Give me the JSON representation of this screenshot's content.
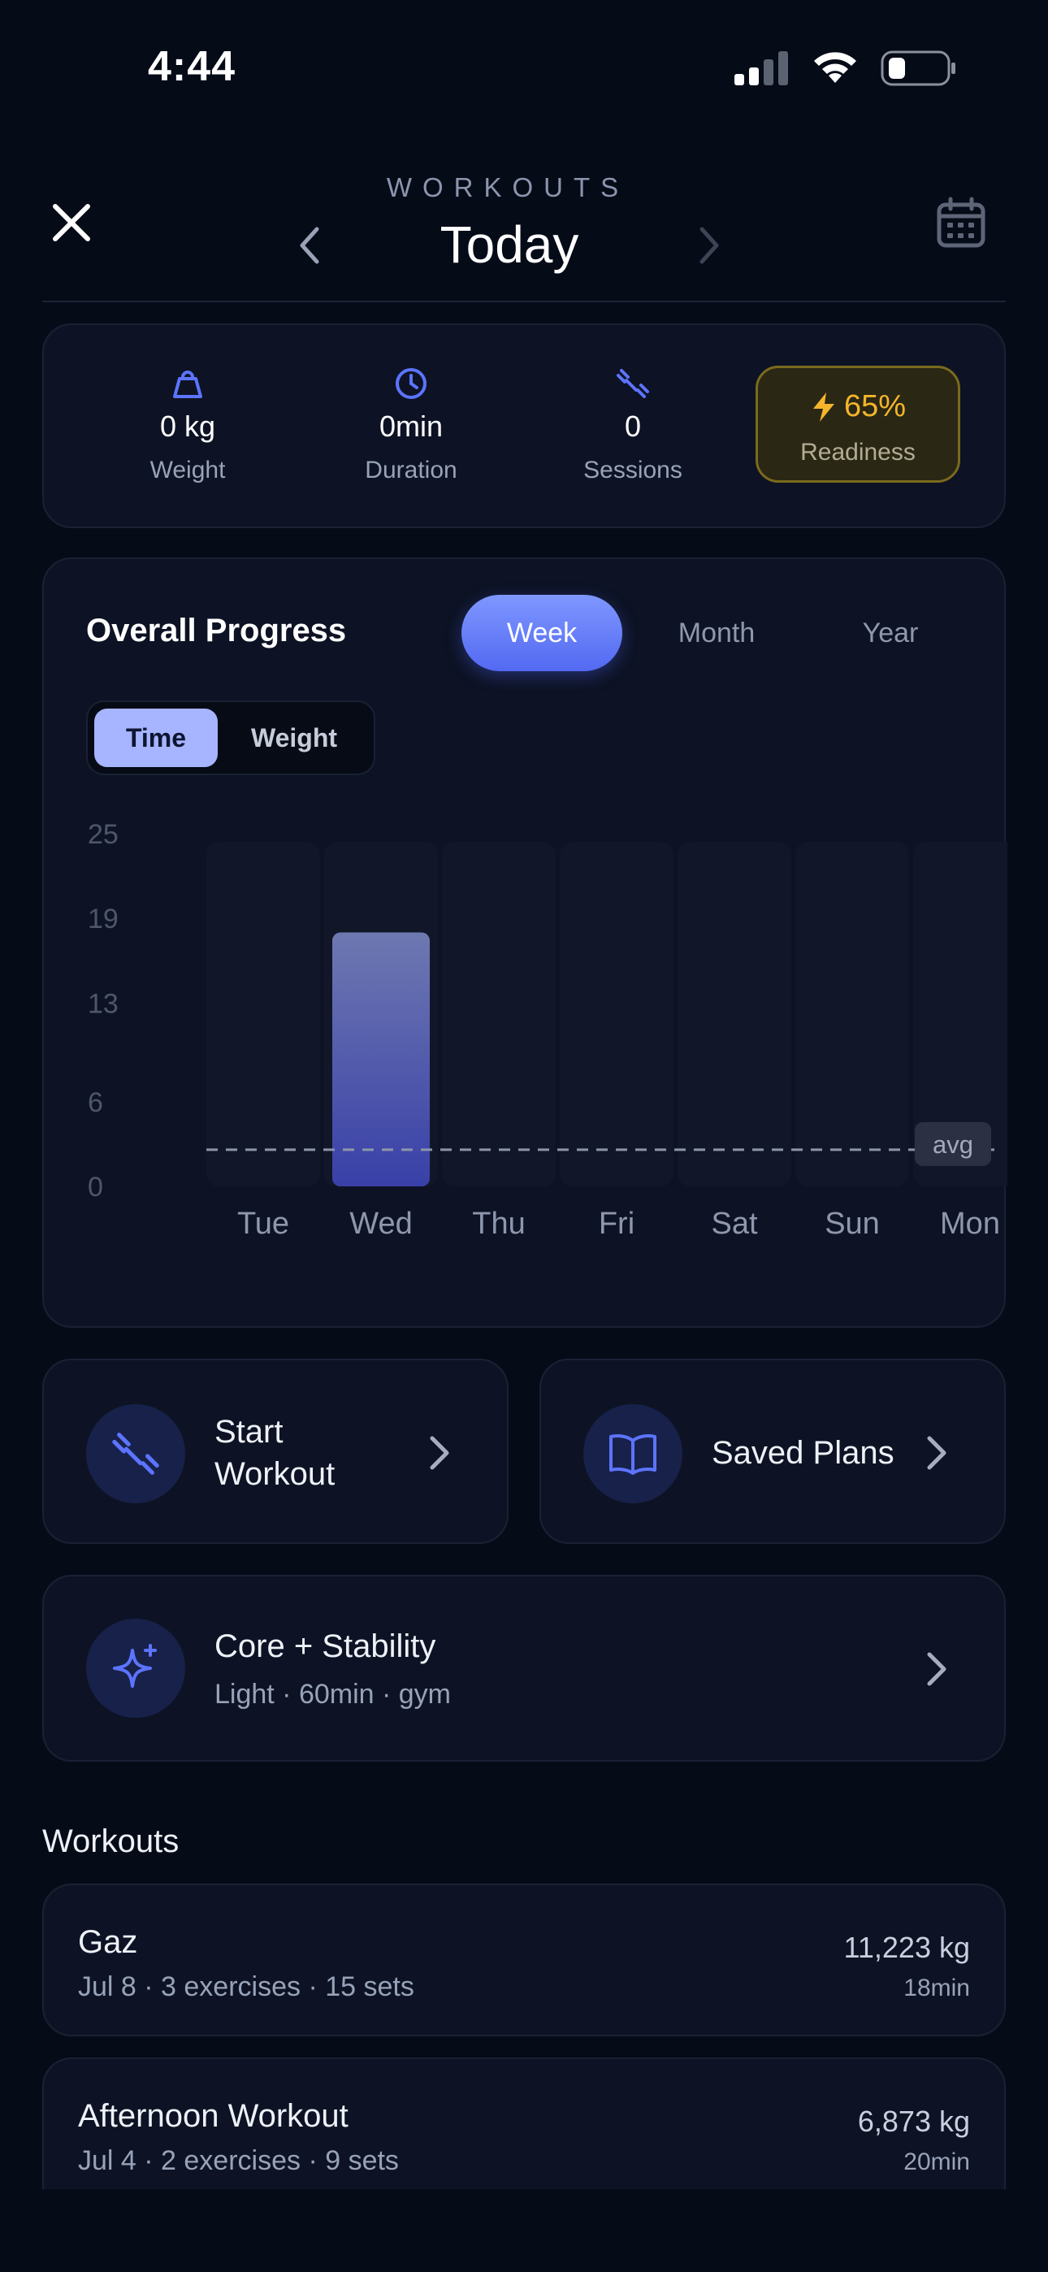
{
  "status": {
    "time": "4:44"
  },
  "header": {
    "eyebrow": "WORKOUTS",
    "title": "Today"
  },
  "stats": [
    {
      "value": "0 kg",
      "label": "Weight",
      "icon": "kettlebell-icon"
    },
    {
      "value": "0min",
      "label": "Duration",
      "icon": "clock-icon"
    },
    {
      "value": "0",
      "label": "Sessions",
      "icon": "dumbbell-icon"
    }
  ],
  "readiness": {
    "value": "65%",
    "label": "Readiness",
    "icon": "bolt-icon"
  },
  "progress": {
    "title": "Overall Progress",
    "range_tabs": [
      "Week",
      "Month",
      "Year"
    ],
    "selected_range": "Week",
    "metric_options": [
      "Time",
      "Weight"
    ],
    "selected_metric": "Time"
  },
  "chart_data": {
    "type": "bar",
    "categories": [
      "Tue",
      "Wed",
      "Thu",
      "Fri",
      "Sat",
      "Sun",
      "Mon"
    ],
    "values": [
      0,
      18,
      0,
      0,
      0,
      0,
      0
    ],
    "yticks": [
      0,
      6,
      13,
      19,
      25
    ],
    "ylim": [
      0,
      25
    ],
    "avg_value": 2.6,
    "avg_label": "avg",
    "title": "",
    "xlabel": "",
    "ylabel": ""
  },
  "actions": [
    {
      "label_line1": "Start",
      "label_line2": "Workout",
      "icon": "dumbbell-icon"
    },
    {
      "label": "Saved Plans",
      "icon": "book-icon"
    }
  ],
  "plan": {
    "title": "Core + Stability",
    "subtitle": "Light · 60min · gym",
    "icon": "sparkle-icon"
  },
  "workouts_title": "Workouts",
  "workouts": [
    {
      "name": "Gaz",
      "meta": "Jul 8 · 3 exercises · 15 sets",
      "weight": "11,223 kg",
      "duration": "18min"
    },
    {
      "name": "Afternoon Workout",
      "meta": "Jul 4 · 2 exercises · 9 sets",
      "weight": "6,873 kg",
      "duration": "20min"
    }
  ],
  "colors": {
    "accent": "#5c74ff",
    "readiness": "#f4b52b",
    "background": "#050b17",
    "card": "#0d1324"
  }
}
